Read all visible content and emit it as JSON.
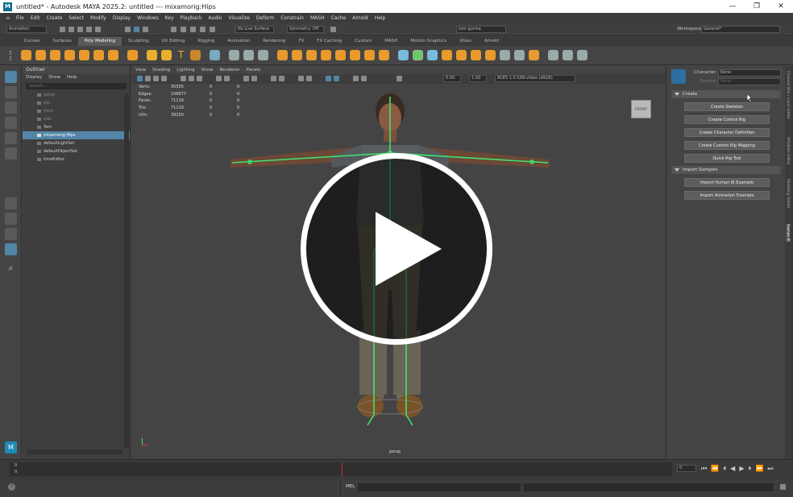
{
  "window": {
    "title": "untitled* - Autodesk MAYA 2025.2: untitled   ---   mixamorig:Hips",
    "min": "—",
    "max": "❐",
    "close": "✕"
  },
  "menubar": [
    "File",
    "Edit",
    "Create",
    "Select",
    "Modify",
    "Display",
    "Windows",
    "Key",
    "Playback",
    "Audio",
    "Visualize",
    "Deform",
    "Constrain",
    "MASH",
    "Cache",
    "Arnold",
    "Help"
  ],
  "statusline": {
    "mode": "Animation",
    "live_surface": "No Live Surface",
    "symmetry": "Symmetry: Off",
    "user": "tom gurma",
    "workspace_label": "Workspace :",
    "workspace_value": "General*"
  },
  "shelf_tabs": [
    "Curves",
    "Surfaces",
    "Poly Modeling",
    "Sculpting",
    "UV Editing",
    "Rigging",
    "Animation",
    "Rendering",
    "FX",
    "FX Caching",
    "Custom",
    "MASH",
    "Motion Graphics",
    "XGen",
    "Arnold"
  ],
  "outliner": {
    "title": "Outliner",
    "menu": [
      "Display",
      "Show",
      "Help"
    ],
    "search_placeholder": "Search...",
    "items": [
      "persp",
      "top",
      "front",
      "side",
      "Tom",
      "mixamorig:Hips",
      "defaultLightSet",
      "defaultObjectSet",
      "timeEditor"
    ]
  },
  "viewport": {
    "menu": [
      "View",
      "Shading",
      "Lighting",
      "Show",
      "Renderer",
      "Panels"
    ],
    "field1": "0.00",
    "field2": "1.00",
    "colorspace": "ACES 1.0 SDR-video (sRGB)",
    "hud": [
      {
        "label": "Verts:",
        "a": "35555",
        "b": "0",
        "c": "0"
      },
      {
        "label": "Edges:",
        "a": "106677",
        "b": "0",
        "c": "0"
      },
      {
        "label": "Faces:",
        "a": "71118",
        "b": "0",
        "c": "0"
      },
      {
        "label": "Tris:",
        "a": "71118",
        "b": "0",
        "c": "0"
      },
      {
        "label": "UVs:",
        "a": "39150",
        "b": "0",
        "c": "0"
      }
    ],
    "view_cube": "FRONT",
    "camera_label": "persp"
  },
  "hik": {
    "character_label": "Character:",
    "character_value": "None",
    "source_label": "Source:",
    "source_value": "None",
    "create_section": "Create",
    "create_buttons": [
      "Create Skeleton",
      "Create Control Rig",
      "Create Character Definition",
      "Create Custom Rig Mapping",
      "Quick Rig Tool"
    ],
    "import_section": "Import Samples",
    "import_buttons": [
      "Import Human IK Example",
      "Import Animation Example"
    ]
  },
  "side_tabs": [
    "Channel Box / Layer Editor",
    "Attribute Editor",
    "Modeling Toolkit",
    "Human IK"
  ],
  "timeline": {
    "start": "0",
    "frame": "0",
    "current": "0"
  },
  "cmdline": {
    "lang": "MEL"
  },
  "colors": {
    "accent": "#5285a6",
    "skeleton": "#3ee36d",
    "bg": "#444444"
  }
}
